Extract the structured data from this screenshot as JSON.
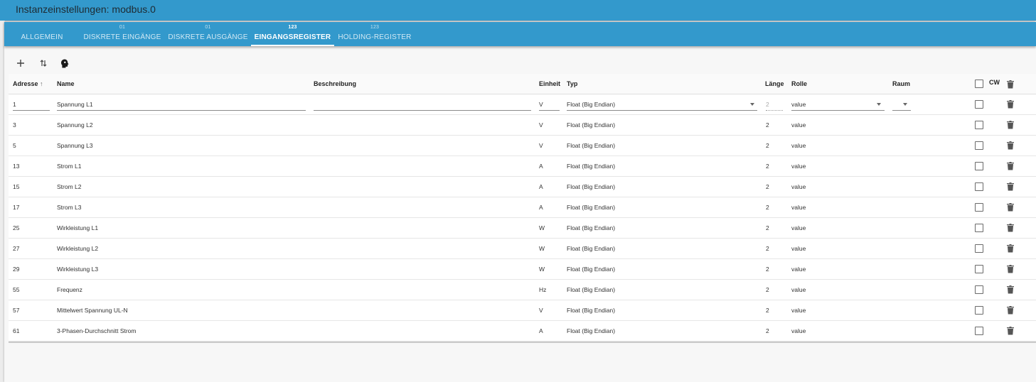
{
  "title": "Instanzeinstellungen: modbus.0",
  "tabs": [
    {
      "sup": "",
      "label": "ALLGEMEIN"
    },
    {
      "sup": "01",
      "label": "DISKRETE EINGÄNGE"
    },
    {
      "sup": "01",
      "label": "DISKRETE AUSGÄNGE"
    },
    {
      "sup": "123",
      "label": "EINGANGSREGISTER"
    },
    {
      "sup": "123",
      "label": "HOLDING-REGISTER"
    }
  ],
  "active_tab": 3,
  "toolbar": [
    "add-icon",
    "sort-icon",
    "head-profile-icon"
  ],
  "columns": {
    "address": "Adresse",
    "sort_arrow": "↑",
    "name": "Name",
    "description": "Beschreibung",
    "unit": "Einheit",
    "type": "Typ",
    "length": "Länge",
    "role": "Rolle",
    "room": "Raum",
    "cw": "CW"
  },
  "rows": [
    {
      "address": "1",
      "name": "Spannung L1",
      "description": "",
      "unit": "V",
      "type": "Float (Big Endian)",
      "length": "2",
      "role": "value",
      "room": "",
      "editing": true
    },
    {
      "address": "3",
      "name": "Spannung L2",
      "description": "",
      "unit": "V",
      "type": "Float (Big Endian)",
      "length": "2",
      "role": "value",
      "room": ""
    },
    {
      "address": "5",
      "name": "Spannung L3",
      "description": "",
      "unit": "V",
      "type": "Float (Big Endian)",
      "length": "2",
      "role": "value",
      "room": ""
    },
    {
      "address": "13",
      "name": "Strom L1",
      "description": "",
      "unit": "A",
      "type": "Float (Big Endian)",
      "length": "2",
      "role": "value",
      "room": ""
    },
    {
      "address": "15",
      "name": "Strom L2",
      "description": "",
      "unit": "A",
      "type": "Float (Big Endian)",
      "length": "2",
      "role": "value",
      "room": ""
    },
    {
      "address": "17",
      "name": "Strom L3",
      "description": "",
      "unit": "A",
      "type": "Float (Big Endian)",
      "length": "2",
      "role": "value",
      "room": ""
    },
    {
      "address": "25",
      "name": "Wirkleistung L1",
      "description": "",
      "unit": "W",
      "type": "Float (Big Endian)",
      "length": "2",
      "role": "value",
      "room": ""
    },
    {
      "address": "27",
      "name": "Wirkleistung L2",
      "description": "",
      "unit": "W",
      "type": "Float (Big Endian)",
      "length": "2",
      "role": "value",
      "room": ""
    },
    {
      "address": "29",
      "name": "Wirkleistung L3",
      "description": "",
      "unit": "W",
      "type": "Float (Big Endian)",
      "length": "2",
      "role": "value",
      "room": ""
    },
    {
      "address": "55",
      "name": "Frequenz",
      "description": "",
      "unit": "Hz",
      "type": "Float (Big Endian)",
      "length": "2",
      "role": "value",
      "room": ""
    },
    {
      "address": "57",
      "name": "Mittelwert Spannung UL-N",
      "description": "",
      "unit": "V",
      "type": "Float (Big Endian)",
      "length": "2",
      "role": "value",
      "room": ""
    },
    {
      "address": "61",
      "name": "3-Phasen-Durchschnitt Strom",
      "description": "",
      "unit": "A",
      "type": "Float (Big Endian)",
      "length": "2",
      "role": "value",
      "room": ""
    }
  ],
  "colors": {
    "accent": "#3399cc",
    "background": "#f7f7f7"
  }
}
